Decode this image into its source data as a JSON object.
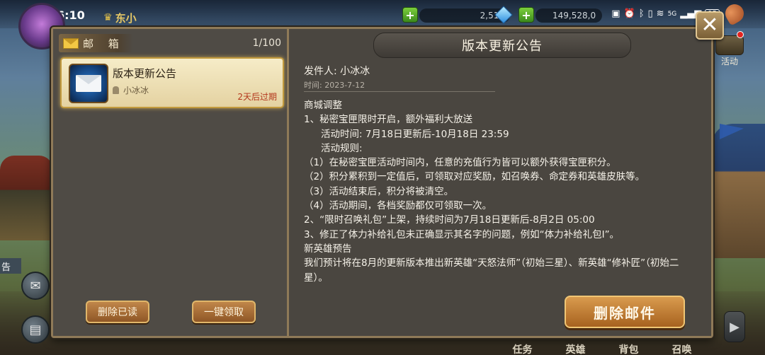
{
  "status_bar": {
    "time": "6:10",
    "battery": "95",
    "signal_text": "5G"
  },
  "hud": {
    "player_name": "东小",
    "gems": "2,518",
    "gold": "149,528,0",
    "event_label": "活动",
    "side_tag": "告",
    "bottom_nav": [
      "任务",
      "英雄",
      "背包",
      "召唤"
    ]
  },
  "mail_list": {
    "title": "邮 箱",
    "count": "1/100",
    "items": [
      {
        "title": "版本更新公告",
        "sender": "小冰冰",
        "expire": "2天后过期",
        "selected": true
      }
    ],
    "delete_read_label": "删除已读",
    "claim_all_label": "一键领取"
  },
  "mail_detail": {
    "header": "版本更新公告",
    "from": "发件人: 小冰冰",
    "date": "时间: 2023-7-12",
    "lines": [
      "商城调整",
      "1、秘密宝匣限时开启，额外福利大放送",
      "活动时间: 7月18日更新后-10月18日 23:59",
      "活动规则:",
      "（1）在秘密宝匣活动时间内，任意的充值行为皆可以额外获得宝匣积分。",
      "（2）积分累积到一定值后，可领取对应奖励，如召唤券、命定券和英雄皮肤等。",
      "（3）活动结束后，积分将被清空。",
      "（4）活动期间，各档奖励都仅可领取一次。",
      "2、“限时召唤礼包”上架，持续时间为7月18日更新后-8月2日 05:00",
      "3、修正了体力补给礼包未正确显示其名字的问题，例如“体力补给礼包Ⅰ”。",
      "新英雄预告",
      "我们预计将在8月的更新版本推出新英雄“天怒法师”（初始三星）、新英雄“修补匠”（初始二星）。"
    ],
    "delete_mail_label": "删除邮件"
  },
  "colors": {
    "frame": "#8f7a58",
    "panel": "#4a4640",
    "button_orange": "#c0864a",
    "expire_red": "#b3361c"
  }
}
